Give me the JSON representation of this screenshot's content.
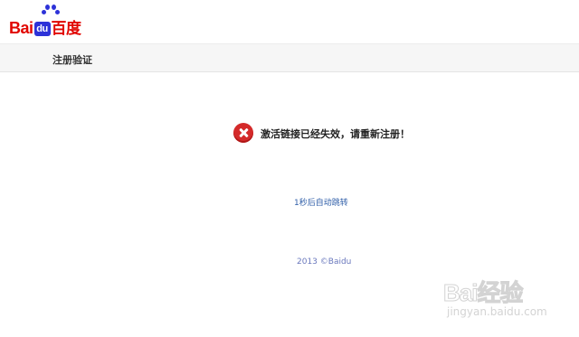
{
  "header": {
    "logo": {
      "bai": "Bai",
      "du": "du",
      "cn": "百度"
    }
  },
  "subbar": {
    "title": "注册验证"
  },
  "message": {
    "icon": "error-x-icon",
    "text": "激活链接已经失效，请重新注册！"
  },
  "redirect": {
    "text": "1秒后自动跳转"
  },
  "footer": {
    "text": "2013 ©Baidu"
  },
  "watermark": {
    "brand": "Bai经验",
    "url": "jingyan.baidu.com"
  },
  "colors": {
    "brand_red": "#e10601",
    "brand_blue": "#2d32d8",
    "error_red": "#d42a2a",
    "link_blue": "#2f5ea8"
  }
}
